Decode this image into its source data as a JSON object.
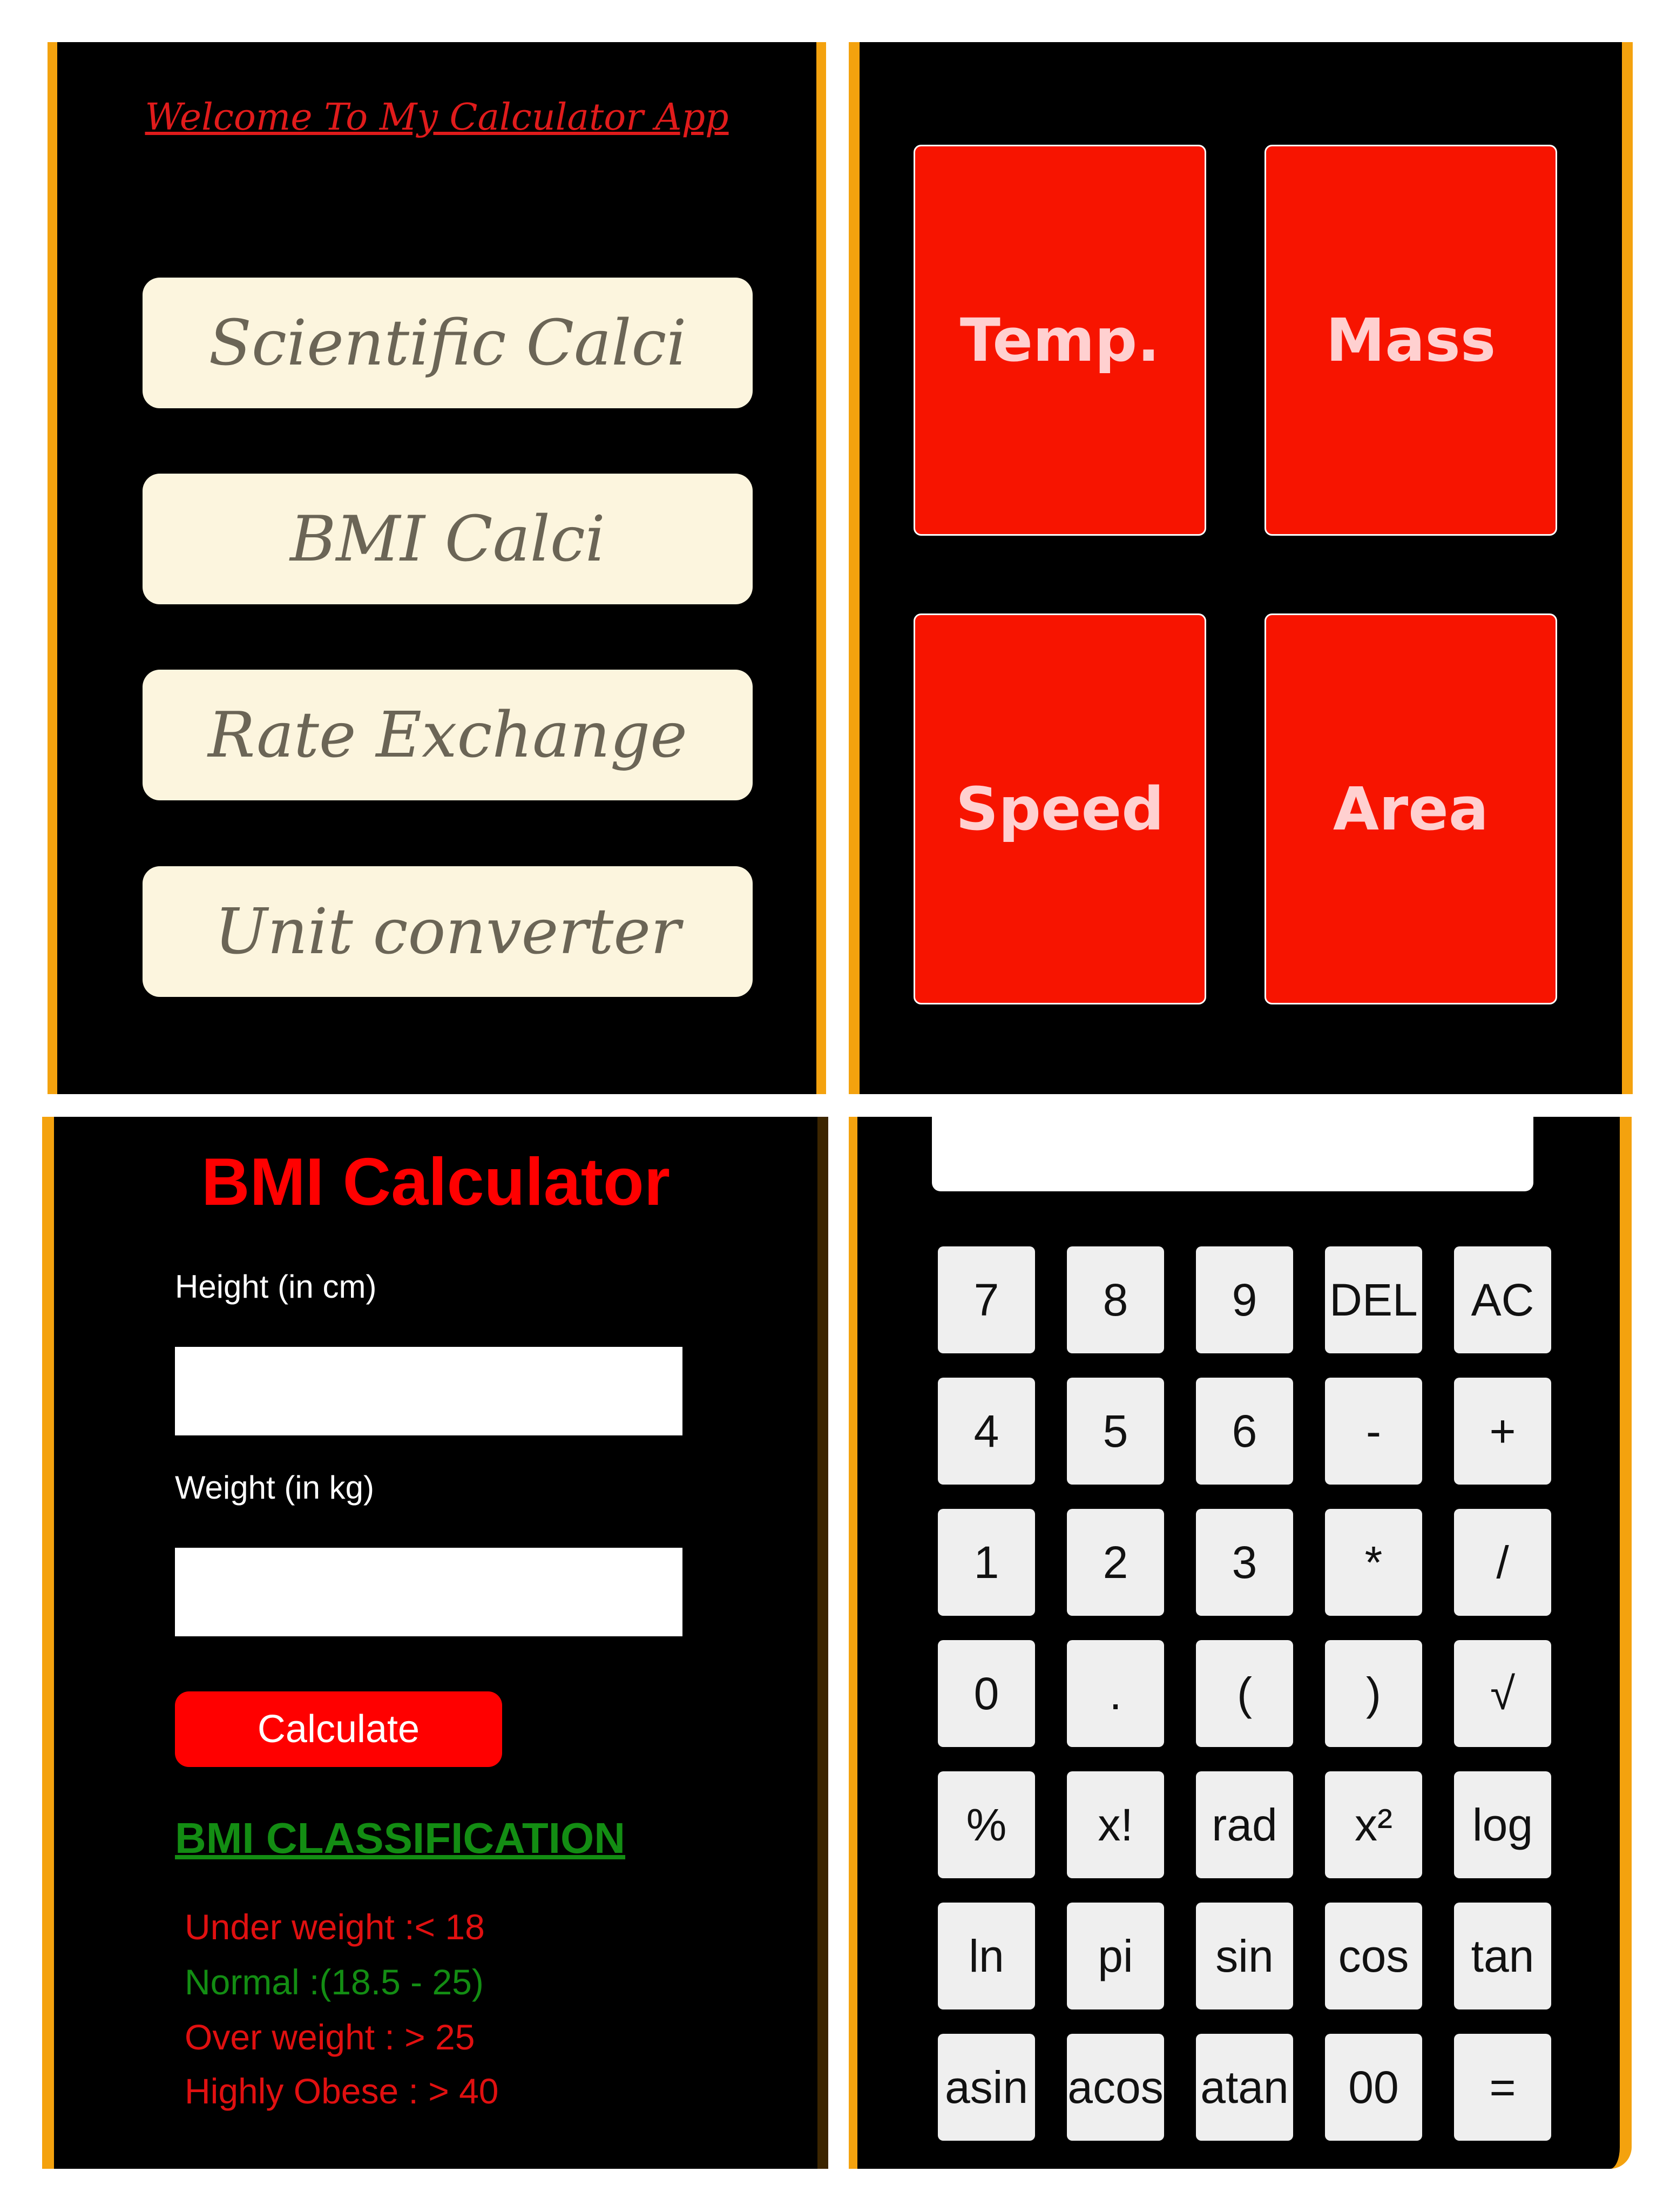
{
  "welcome_screen": {
    "title": "Welcome To My Calculator App",
    "buttons": [
      "Scientific Calci",
      "BMI Calci",
      "Rate Exchange",
      "Unit converter"
    ]
  },
  "unit_converter": {
    "tiles": [
      "Temp.",
      "Mass",
      "Speed",
      "Area"
    ]
  },
  "bmi": {
    "title": "BMI Calculator",
    "height_label": "Height (in cm)",
    "height_value": "",
    "weight_label": "Weight (in kg)",
    "weight_value": "",
    "calculate_label": "Calculate",
    "classification_title": "BMI CLASSIFICATION",
    "classes": [
      {
        "text": "Under weight :< 18",
        "color": "#e01010"
      },
      {
        "text": "Normal :(18.5 - 25)",
        "color": "#138d13"
      },
      {
        "text": "Over weight : > 25",
        "color": "#e01010"
      },
      {
        "text": "Highly Obese : > 40",
        "color": "#e01010"
      }
    ]
  },
  "calculator": {
    "display_value": "",
    "keys": [
      [
        "7",
        "8",
        "9",
        "DEL",
        "AC"
      ],
      [
        "4",
        "5",
        "6",
        "-",
        "+"
      ],
      [
        "1",
        "2",
        "3",
        "*",
        "/"
      ],
      [
        "0",
        ".",
        "(",
        ")",
        "√"
      ],
      [
        "%",
        "x!",
        "rad",
        "x²",
        "log"
      ],
      [
        "ln",
        "pi",
        "sin",
        "cos",
        "tan"
      ],
      [
        "asin",
        "acos",
        "atan",
        "00",
        "="
      ]
    ]
  },
  "colors": {
    "accent_orange": "#f4a20e",
    "tile_red": "#f71400",
    "menu_cream": "#fcf5de",
    "classification_green": "#138d13"
  }
}
